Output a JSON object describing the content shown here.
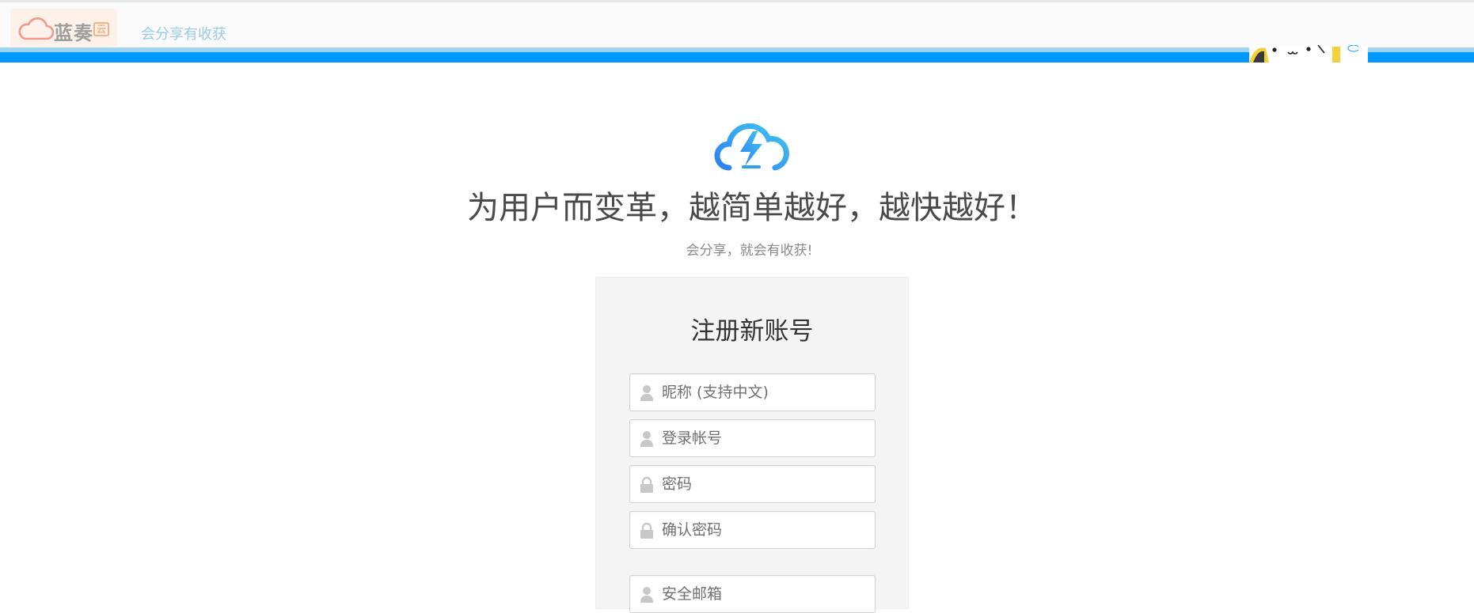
{
  "header": {
    "logo_text": "蓝奏",
    "logo_badge": "云",
    "slogan_link": "会分享有收获"
  },
  "hero": {
    "title": "为用户而变革，越简单越好，越快越好！",
    "subtitle": "会分享，就会有收获!"
  },
  "register": {
    "title": "注册新账号",
    "fields": [
      {
        "placeholder": "昵称 (支持中文)",
        "icon": "user-icon"
      },
      {
        "placeholder": "登录帐号",
        "icon": "user-icon"
      },
      {
        "placeholder": "密码",
        "icon": "lock-icon"
      },
      {
        "placeholder": "确认密码",
        "icon": "lock-icon"
      },
      {
        "placeholder": "安全邮箱",
        "icon": "user-icon"
      }
    ]
  },
  "colors": {
    "brand_blue": "#0099ff",
    "stripe_light": "#9fd4f5",
    "logo_accent": "#f4b183"
  }
}
